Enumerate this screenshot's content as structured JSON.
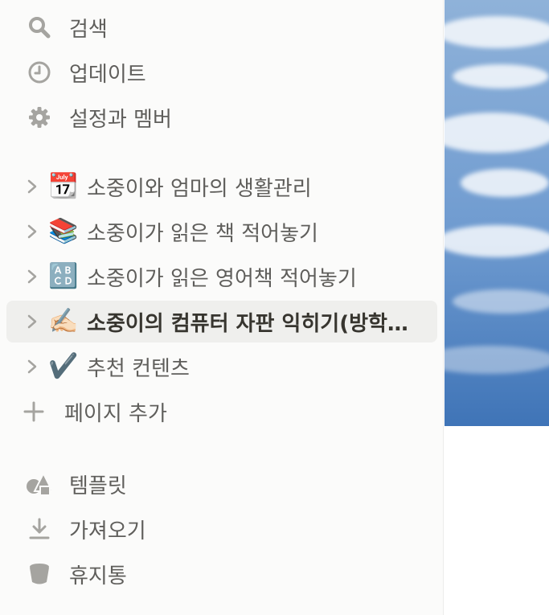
{
  "nav": {
    "search_label": "검색",
    "updates_label": "업데이트",
    "settings_label": "설정과 멤버"
  },
  "pages": [
    {
      "emoji": "📆",
      "label": "소중이와 엄마의 생활관리"
    },
    {
      "emoji": "📚",
      "label": "소중이가 읽은 책 적어놓기"
    },
    {
      "emoji": "🔠",
      "label": "소중이가 읽은 영어책 적어놓기"
    },
    {
      "emoji": "✍🏻",
      "label": "소중이의 컴퓨터 자판 익히기(방학…",
      "active": true
    },
    {
      "emoji": "✔️",
      "label": "추천 컨텐츠"
    }
  ],
  "add_page_label": "페이지 추가",
  "footer": {
    "templates_label": "템플릿",
    "import_label": "가져오기",
    "trash_label": "휴지통"
  },
  "icons": {
    "search": "search-icon",
    "updates": "clock-icon",
    "settings": "gear-icon",
    "add": "plus-icon",
    "templates": "shapes-icon",
    "import": "download-icon",
    "trash": "trash-icon"
  },
  "colors": {
    "sidebar_bg": "#fbfbfa",
    "text": "#5f5e5b",
    "active_bg": "#efefed",
    "icon": "#a5a4a0"
  }
}
